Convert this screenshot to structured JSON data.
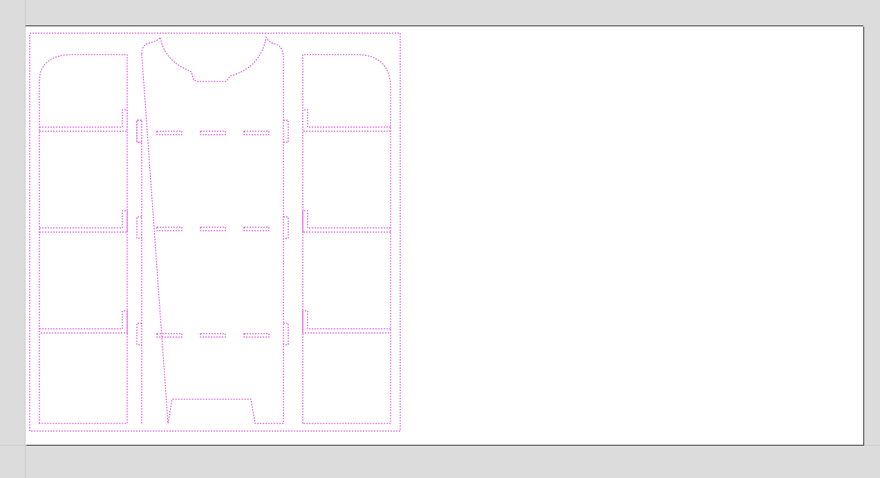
{
  "canvas": {
    "workspace_color": "#dcdcdc",
    "artboard_color": "#ffffff",
    "cut_line_color": "#d000d0"
  },
  "drawing": {
    "outline_style": "dashed",
    "parts": [
      {
        "id": "outer-frame",
        "kind": "bounding-rectangle"
      },
      {
        "id": "left-side-panel",
        "kind": "side-panel",
        "shelf_slots": 3
      },
      {
        "id": "center-back-panel",
        "kind": "back-panel",
        "shelf_rows": 3,
        "slots_per_row": 3
      },
      {
        "id": "right-side-panel",
        "kind": "side-panel",
        "shelf_slots": 3
      }
    ]
  }
}
